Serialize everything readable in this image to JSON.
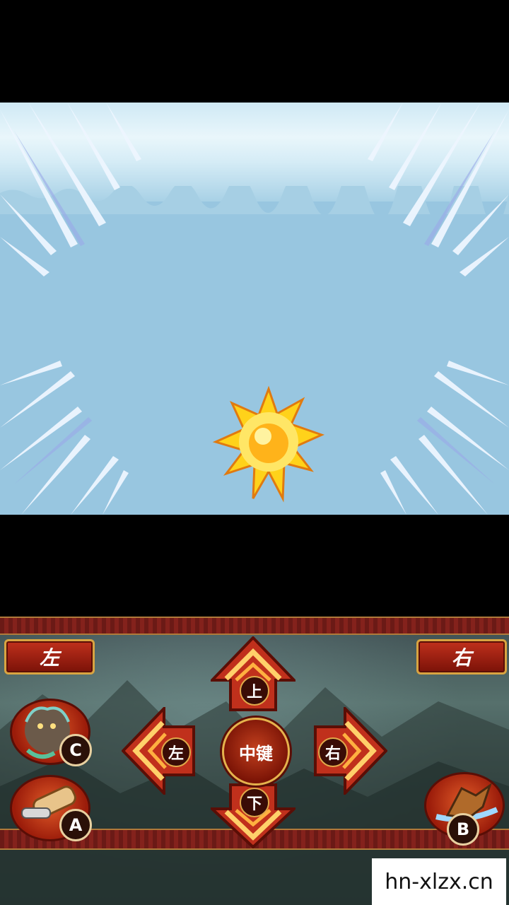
{
  "controller": {
    "shoulder_left": "左",
    "shoulder_right": "右",
    "dpad": {
      "up": "上",
      "down": "下",
      "left": "左",
      "right": "右"
    },
    "center_key": "中键",
    "buttons": {
      "a": "A",
      "b": "B",
      "c": "C"
    }
  },
  "watermark": "hn-xlzx.cn",
  "colors": {
    "sky": "#98c6e0",
    "frame_red": "#c0301c",
    "frame_gold": "#d9a441"
  }
}
